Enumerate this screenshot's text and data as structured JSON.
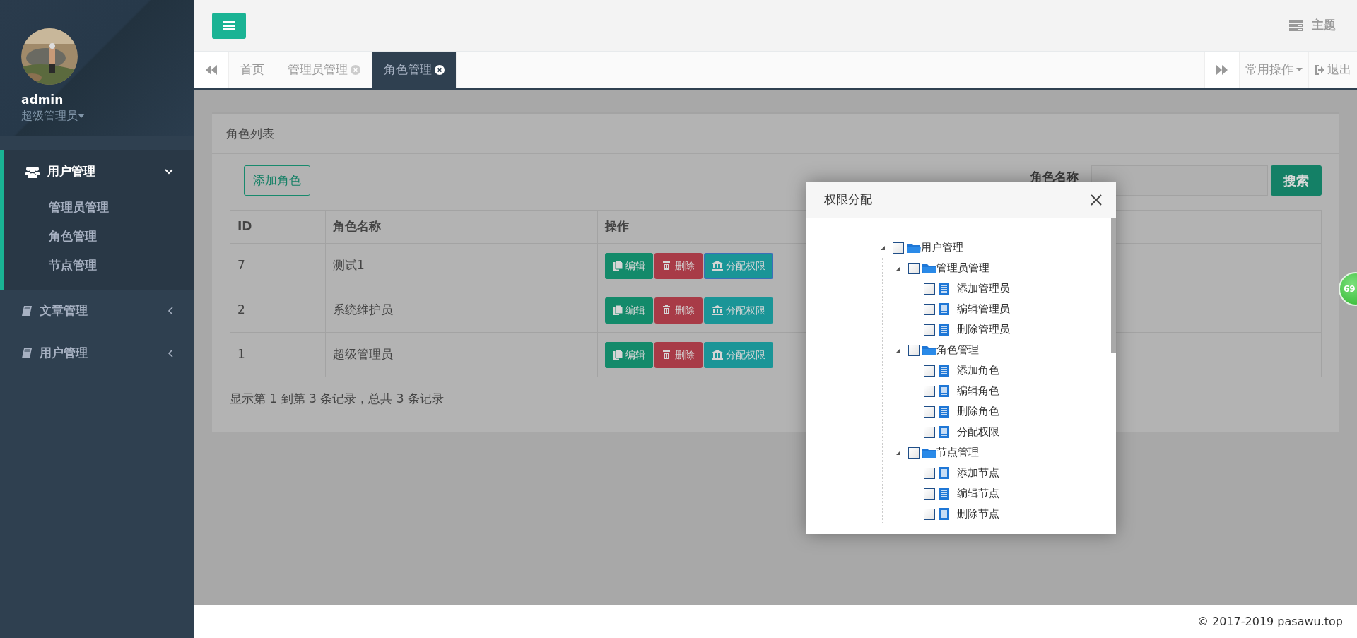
{
  "sidebar": {
    "user": {
      "name": "admin",
      "role": "超级管理员"
    },
    "menu": [
      {
        "label": "用户管理",
        "expanded": true,
        "children": [
          {
            "label": "管理员管理"
          },
          {
            "label": "角色管理"
          },
          {
            "label": "节点管理"
          }
        ]
      },
      {
        "label": "文章管理",
        "expanded": false
      },
      {
        "label": "用户管理",
        "expanded": false
      }
    ]
  },
  "topbar": {
    "theme_label": "主题"
  },
  "tabs": [
    {
      "label": "首页",
      "selected": false,
      "closable": false
    },
    {
      "label": "管理员管理",
      "selected": false,
      "closable": true
    },
    {
      "label": "角色管理",
      "selected": true,
      "closable": true
    }
  ],
  "tab_actions": {
    "menu_label": "常用操作",
    "logout_label": "退出"
  },
  "panel": {
    "title": "角色列表",
    "add_button": "添加角色",
    "search_label": "角色名称",
    "search_button": "搜索",
    "table": {
      "columns": [
        "ID",
        "角色名称",
        "操作"
      ],
      "rows": [
        {
          "id": "7",
          "name": "测试1",
          "actions": [
            {
              "kind": "edit",
              "label": "编辑",
              "focused": false
            },
            {
              "kind": "delete",
              "label": "删除",
              "focused": false
            },
            {
              "kind": "assign",
              "label": "分配权限",
              "focused": true
            }
          ]
        },
        {
          "id": "2",
          "name": "系统维护员",
          "actions": [
            {
              "kind": "edit",
              "label": "编辑",
              "focused": false
            },
            {
              "kind": "delete",
              "label": "删除",
              "focused": false
            },
            {
              "kind": "assign",
              "label": "分配权限",
              "focused": false
            }
          ]
        },
        {
          "id": "1",
          "name": "超级管理员",
          "actions": [
            {
              "kind": "edit",
              "label": "编辑",
              "focused": false
            },
            {
              "kind": "delete",
              "label": "删除",
              "focused": false
            },
            {
              "kind": "assign",
              "label": "分配权限",
              "focused": false
            }
          ]
        }
      ]
    },
    "pagination_info": "显示第 1 到第 3 条记录，总共 3 条记录"
  },
  "modal": {
    "title": "权限分配",
    "tree": [
      {
        "label": "用户管理",
        "checked": false,
        "expanded": true,
        "children": [
          {
            "label": "管理员管理",
            "checked": false,
            "expanded": true,
            "children": [
              {
                "label": "添加管理员",
                "checked": false
              },
              {
                "label": "编辑管理员",
                "checked": false
              },
              {
                "label": "删除管理员",
                "checked": false
              }
            ]
          },
          {
            "label": "角色管理",
            "checked": false,
            "expanded": true,
            "children": [
              {
                "label": "添加角色",
                "checked": false
              },
              {
                "label": "编辑角色",
                "checked": false
              },
              {
                "label": "删除角色",
                "checked": false
              },
              {
                "label": "分配权限",
                "checked": false
              }
            ]
          },
          {
            "label": "节点管理",
            "checked": false,
            "expanded": true,
            "children": [
              {
                "label": "添加节点",
                "checked": false
              },
              {
                "label": "编辑节点",
                "checked": false
              },
              {
                "label": "删除节点",
                "checked": false
              }
            ]
          }
        ]
      }
    ]
  },
  "badge": "69",
  "footer": "© 2017-2019 pasawu.top"
}
